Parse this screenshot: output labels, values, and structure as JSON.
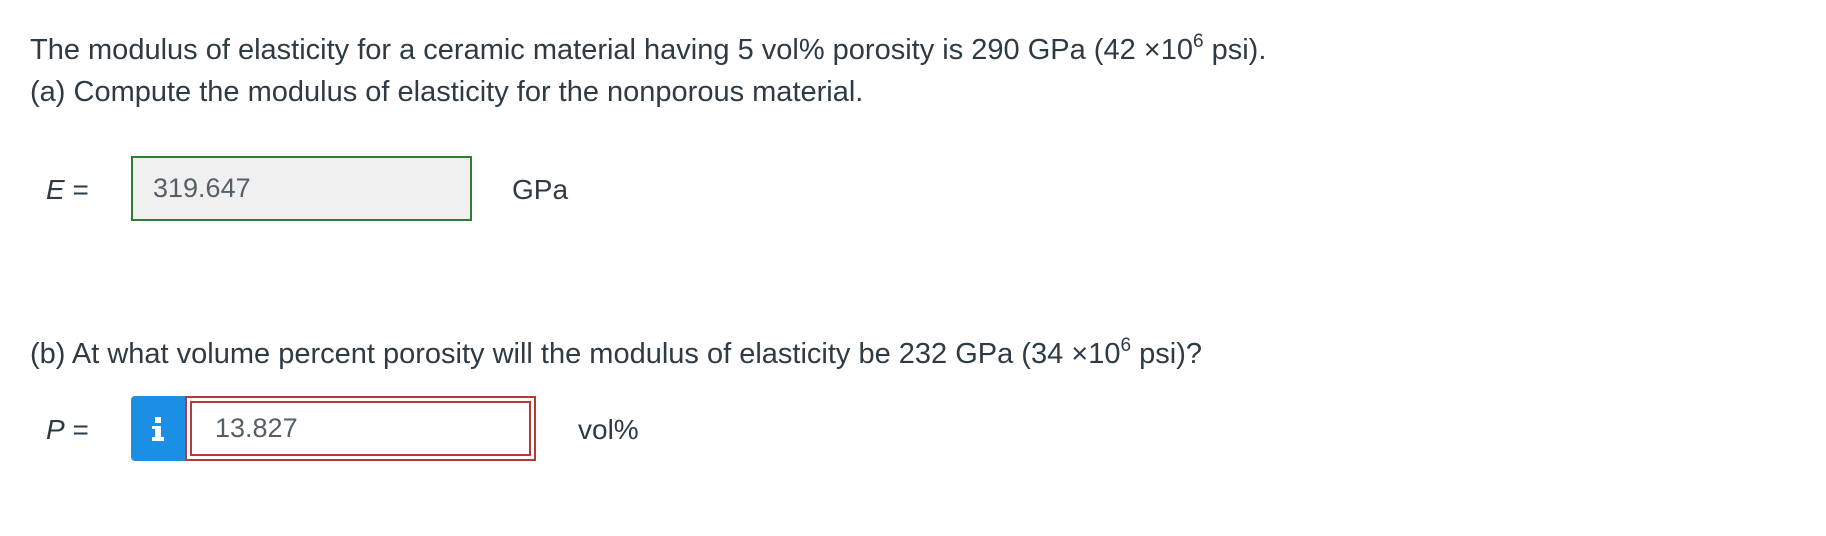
{
  "question": {
    "intro_before": "The modulus of elasticity for a ceramic material having 5 vol% porosity is 290 GPa (42 ×10",
    "intro_exp": "6",
    "intro_after": " psi).",
    "part_a": "(a) Compute the modulus of elasticity for the nonporous material.",
    "part_b_before": "(b) At what volume percent porosity will the modulus of elasticity be 232 GPa (34 ×10",
    "part_b_exp": "6",
    "part_b_after": " psi)?"
  },
  "answer_a": {
    "symbol": "E",
    "equals": " =",
    "value": "319.647",
    "unit": "GPa",
    "status": "correct",
    "status_color": "#2e7d32"
  },
  "answer_b": {
    "symbol": "P",
    "equals": " =",
    "info_icon": "info-icon",
    "value": "13.827",
    "unit": "vol%",
    "status": "incorrect",
    "status_color": "#b23a3a",
    "info_color": "#1a8fe3"
  }
}
